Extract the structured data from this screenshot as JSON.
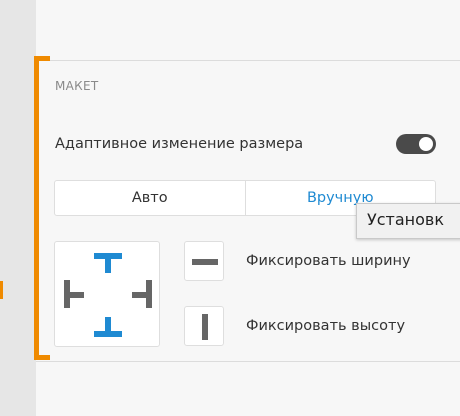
{
  "section": {
    "title": "МАКЕТ",
    "adaptive_resize_label": "Адаптивное изменение размера",
    "adaptive_resize_enabled": true
  },
  "mode_segment": {
    "options": [
      "Авто",
      "Вручную"
    ],
    "selected": "Вручную"
  },
  "fix_options": {
    "fix_width_label": "Фиксировать ширину",
    "fix_height_label": "Фиксировать высоту"
  },
  "tooltip": {
    "text": "Установк"
  },
  "colors": {
    "accent_orange": "#ef8a00",
    "selected_blue": "#1f8ad2",
    "anchor_gray": "#666666",
    "toggle_on": "#4a4a4a"
  },
  "icons": {
    "anchor_top": "anchor-top-icon",
    "anchor_bottom": "anchor-bottom-icon",
    "anchor_left": "anchor-left-icon",
    "anchor_right": "anchor-right-icon",
    "fix_width": "horizontal-bar-icon",
    "fix_height": "vertical-bar-icon"
  }
}
